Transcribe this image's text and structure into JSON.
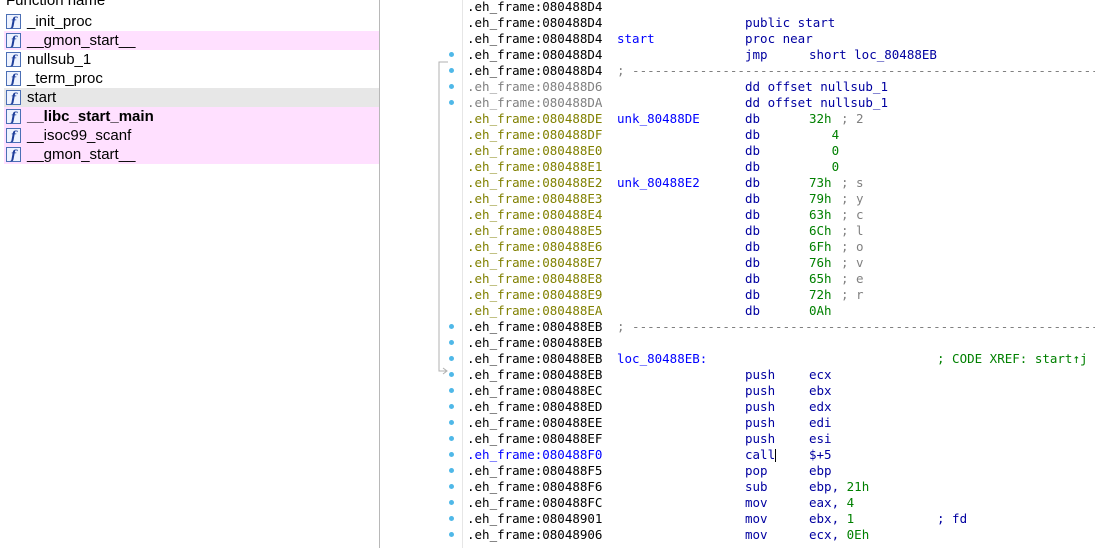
{
  "functions_panel": {
    "header": "Function name",
    "items": [
      {
        "label": "_init_proc",
        "icon": "function-icon",
        "style": "normal"
      },
      {
        "label": "__gmon_start__",
        "icon": "function-icon",
        "style": "lib"
      },
      {
        "label": "nullsub_1",
        "icon": "function-icon",
        "style": "normal"
      },
      {
        "label": "_term_proc",
        "icon": "function-icon",
        "style": "normal"
      },
      {
        "label": "start",
        "icon": "function-icon",
        "style": "selected"
      },
      {
        "label": "__libc_start_main",
        "icon": "function-icon",
        "style": "lib-bold"
      },
      {
        "label": "__isoc99_scanf",
        "icon": "function-icon",
        "style": "lib"
      },
      {
        "label": "__gmon_start__",
        "icon": "function-icon",
        "style": "lib"
      }
    ]
  },
  "disassembly": {
    "lines": [
      {
        "addr": ".eh_frame:080488D4",
        "seg": "black"
      },
      {
        "addr": ".eh_frame:080488D4",
        "seg": "black",
        "mnem": "public start"
      },
      {
        "addr": ".eh_frame:080488D4",
        "seg": "black",
        "label": "start",
        "mnem": "proc near"
      },
      {
        "addr": ".eh_frame:080488D4",
        "seg": "black",
        "mnem": "jmp",
        "operand": "short loc_80488EB"
      },
      {
        "addr": ".eh_frame:080488D4",
        "seg": "black",
        "dash": "; -------------------------------------------------------------------------"
      },
      {
        "addr": ".eh_frame:080488D6",
        "seg": "gray",
        "mnem": "dd offset nullsub_1"
      },
      {
        "addr": ".eh_frame:080488DA",
        "seg": "gray",
        "mnem": "dd offset nullsub_1"
      },
      {
        "addr": ".eh_frame:080488DE",
        "seg": "olive",
        "label": "unk_80488DE",
        "mnem": "db",
        "num": "32h",
        "comment": "; 2"
      },
      {
        "addr": ".eh_frame:080488DF",
        "seg": "olive",
        "mnem": "db",
        "num": "   4"
      },
      {
        "addr": ".eh_frame:080488E0",
        "seg": "olive",
        "mnem": "db",
        "num": "   0"
      },
      {
        "addr": ".eh_frame:080488E1",
        "seg": "olive",
        "mnem": "db",
        "num": "   0"
      },
      {
        "addr": ".eh_frame:080488E2",
        "seg": "olive",
        "label": "unk_80488E2",
        "mnem": "db",
        "num": "73h",
        "comment": "; s"
      },
      {
        "addr": ".eh_frame:080488E3",
        "seg": "olive",
        "mnem": "db",
        "num": "79h",
        "comment": "; y"
      },
      {
        "addr": ".eh_frame:080488E4",
        "seg": "olive",
        "mnem": "db",
        "num": "63h",
        "comment": "; c"
      },
      {
        "addr": ".eh_frame:080488E5",
        "seg": "olive",
        "mnem": "db",
        "num": "6Ch",
        "comment": "; l"
      },
      {
        "addr": ".eh_frame:080488E6",
        "seg": "olive",
        "mnem": "db",
        "num": "6Fh",
        "comment": "; o"
      },
      {
        "addr": ".eh_frame:080488E7",
        "seg": "olive",
        "mnem": "db",
        "num": "76h",
        "comment": "; v"
      },
      {
        "addr": ".eh_frame:080488E8",
        "seg": "olive",
        "mnem": "db",
        "num": "65h",
        "comment": "; e"
      },
      {
        "addr": ".eh_frame:080488E9",
        "seg": "olive",
        "mnem": "db",
        "num": "72h",
        "comment": "; r"
      },
      {
        "addr": ".eh_frame:080488EA",
        "seg": "olive",
        "mnem": "db",
        "num": "0Ah"
      },
      {
        "addr": ".eh_frame:080488EB",
        "seg": "black",
        "dash": "; -------------------------------------------------------------------------"
      },
      {
        "addr": ".eh_frame:080488EB",
        "seg": "black"
      },
      {
        "addr": ".eh_frame:080488EB",
        "seg": "black",
        "label": "loc_80488EB:",
        "xref": "; CODE XREF: start↑j"
      },
      {
        "addr": ".eh_frame:080488EB",
        "seg": "black",
        "mnem": "push",
        "operand": "ecx"
      },
      {
        "addr": ".eh_frame:080488EC",
        "seg": "black",
        "mnem": "push",
        "operand": "ebx"
      },
      {
        "addr": ".eh_frame:080488ED",
        "seg": "black",
        "mnem": "push",
        "operand": "edx"
      },
      {
        "addr": ".eh_frame:080488EE",
        "seg": "black",
        "mnem": "push",
        "operand": "edi"
      },
      {
        "addr": ".eh_frame:080488EF",
        "seg": "black",
        "mnem": "push",
        "operand": "esi"
      },
      {
        "addr": ".eh_frame:080488F0",
        "seg": "blue",
        "mnem": "call",
        "operand": "$+5",
        "cursor": true
      },
      {
        "addr": ".eh_frame:080488F5",
        "seg": "black",
        "mnem": "pop",
        "operand": "ebp"
      },
      {
        "addr": ".eh_frame:080488F6",
        "seg": "black",
        "mnem": "sub",
        "operand": "ebp, ",
        "num_after": "21h"
      },
      {
        "addr": ".eh_frame:080488FC",
        "seg": "black",
        "mnem": "mov",
        "operand": "eax, ",
        "num_after": "4"
      },
      {
        "addr": ".eh_frame:08048901",
        "seg": "black",
        "mnem": "mov",
        "operand": "ebx, ",
        "num_after": "1",
        "comment": "; fd"
      },
      {
        "addr": ".eh_frame:08048906",
        "seg": "black",
        "mnem": "mov",
        "operand": "ecx, ",
        "num_after": "0Eh"
      }
    ]
  },
  "colors": {
    "lib_function_bg": "#ffe0ff",
    "selected_function_bg": "#e7e7e7",
    "breakpoint_dot": "#4fb8e8",
    "label_blue": "#0000ff",
    "instruction_navy": "#0000a0",
    "number_green": "#008000",
    "data_olive": "#808000"
  }
}
